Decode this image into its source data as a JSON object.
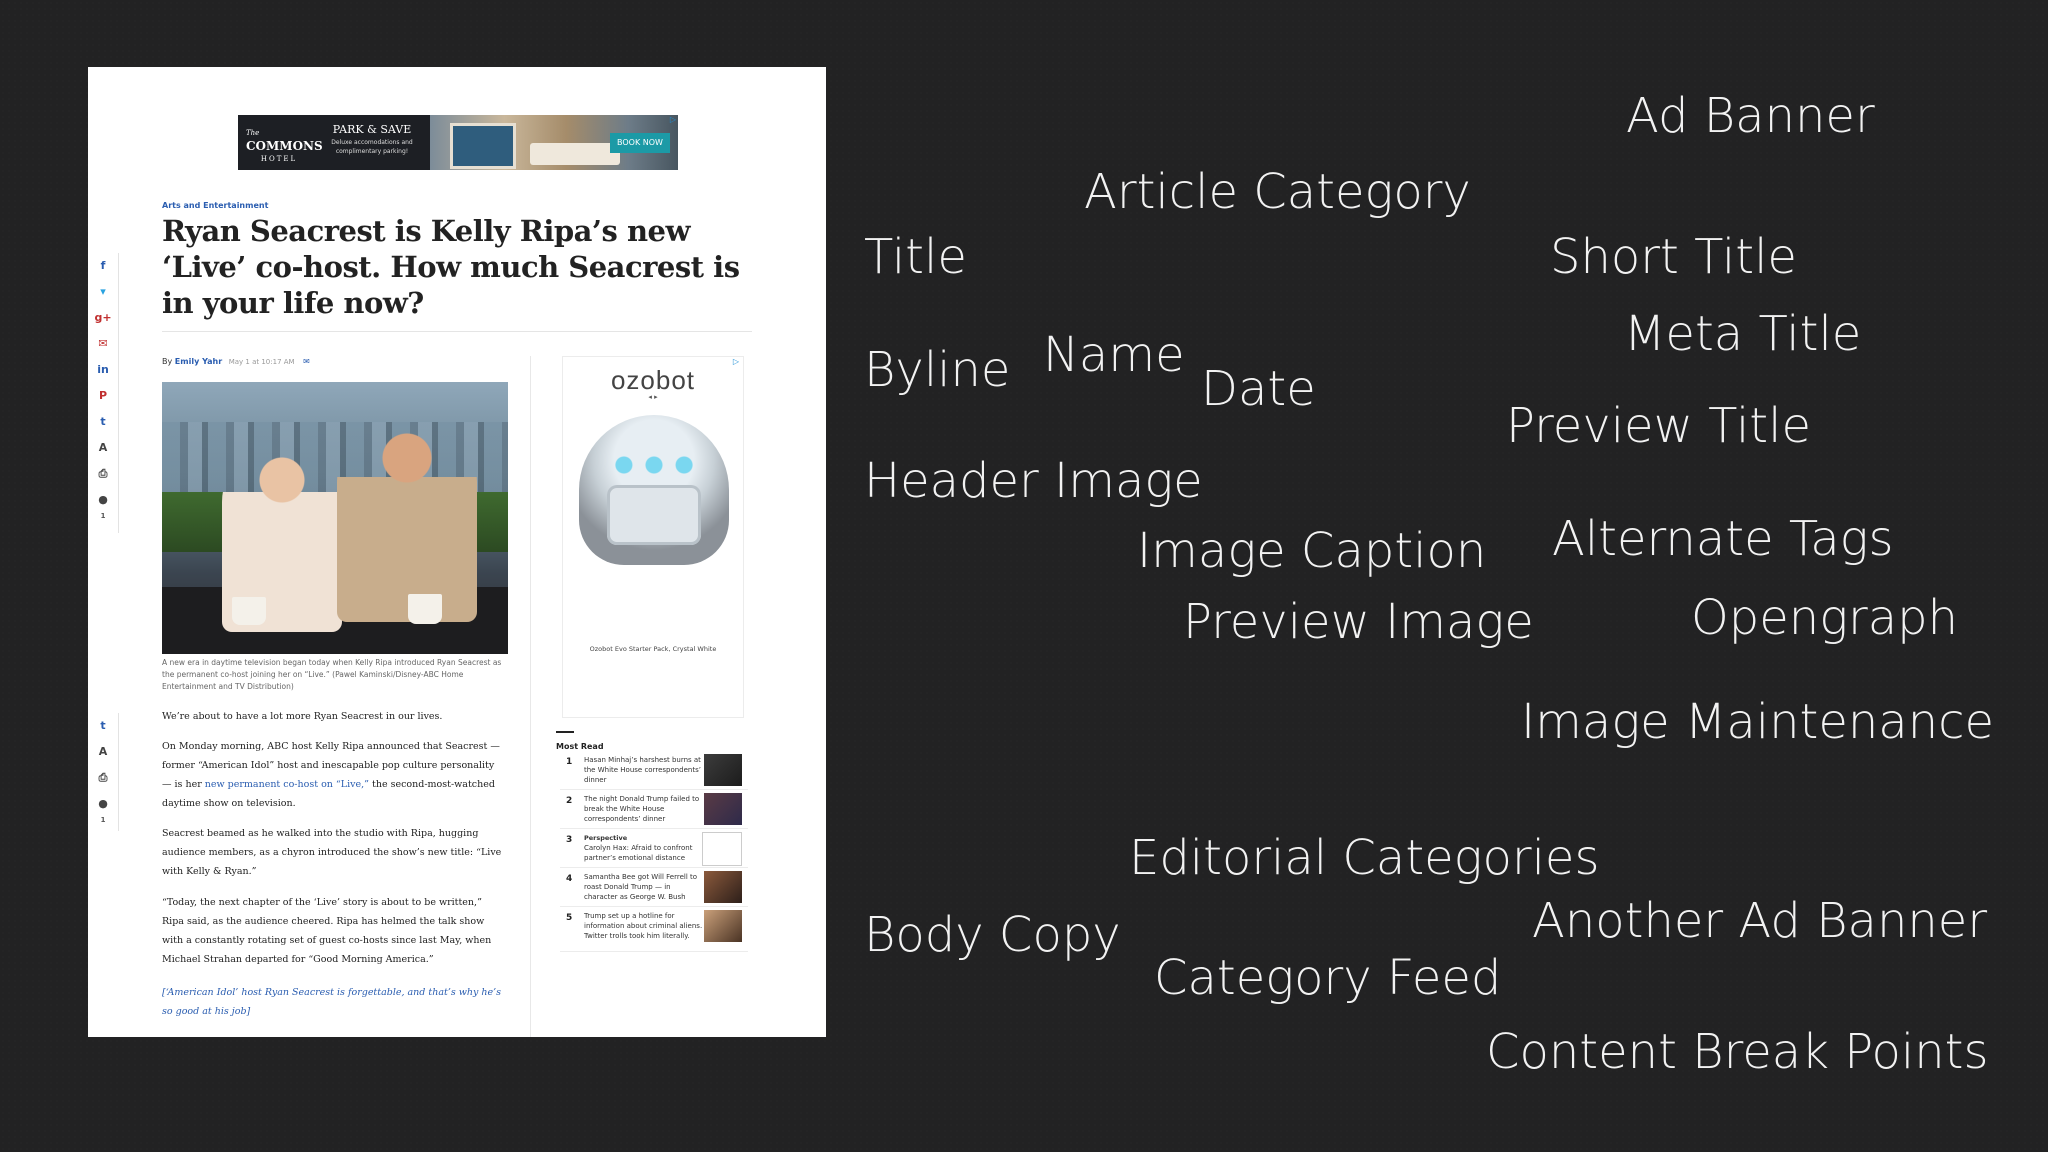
{
  "article_page": {
    "ad_banner": {
      "logo_small": "The",
      "logo": "COMMONS",
      "logo_sub": "HOTEL",
      "headline": "PARK & SAVE",
      "description": "Deluxe accomodations and complimentary parking!",
      "button": "BOOK NOW"
    },
    "category": "Arts and Entertainment",
    "title": "Ryan Seacrest is Kelly Ripa’s new ‘Live’ co-host. How much Seacrest is in your life now?",
    "byline": {
      "prefix": "By",
      "author": "Emily Yahr",
      "date": "May 1 at 10:17 AM"
    },
    "share_rail": {
      "buttons": [
        {
          "icon": "facebook-icon",
          "glyph": "f"
        },
        {
          "icon": "twitter-icon",
          "glyph": "🐦"
        },
        {
          "icon": "googleplus-icon",
          "glyph": "g+"
        },
        {
          "icon": "email-icon",
          "glyph": "✉"
        },
        {
          "icon": "linkedin-icon",
          "glyph": "in"
        },
        {
          "icon": "pinterest-icon",
          "glyph": "P"
        },
        {
          "icon": "tumblr-icon",
          "glyph": "t"
        },
        {
          "icon": "text-size-icon",
          "glyph": "A"
        },
        {
          "icon": "print-icon",
          "glyph": "⎙"
        },
        {
          "icon": "comment-icon",
          "glyph": "💬"
        }
      ],
      "comment_count": "1"
    },
    "caption": "A new era in daytime television began today when Kelly Ripa introduced Ryan Seacrest as the permanent co-host joining her on “Live.” (Pawel Kaminski/Disney-ABC Home Entertainment and TV Distribution)",
    "body": {
      "p1": "We’re about to have a lot more Ryan Seacrest in our lives.",
      "p2_before": "On Monday morning, ABC host Kelly Ripa announced that Seacrest — former “American Idol” host and inescapable pop culture personality — is her ",
      "p2_link": "new permanent co-host on “Live,”",
      "p2_after": " the second-most-watched daytime show on television.",
      "p3": "Seacrest beamed as he walked into the studio with Ripa, hugging audience members, as a chyron introduced the show’s new title: “Live with Kelly & Ryan.”",
      "p4": "“Today, the next chapter of the ‘Live’ story is about to be written,” Ripa said, as the audience cheered. Ripa has helmed the talk show with a constantly rotating set of guest co-hosts since last May, when Michael Strahan departed for “Good Morning America.”",
      "related": "[‘American Idol’ host Ryan Seacrest is forgettable, and that’s why he’s so good at his job]"
    },
    "sidebar_ad": {
      "brand": "ozobot",
      "arrows": "◂        ▸",
      "product": "Ozobot Evo Starter Pack, Crystal White"
    },
    "most_read": {
      "heading": "Most Read",
      "items": [
        {
          "num": "1",
          "kicker": "",
          "text": "Hasan Minhaj’s harshest burns at the White House correspondents’ dinner"
        },
        {
          "num": "2",
          "kicker": "",
          "text": "The night Donald Trump failed to break the White House correspondents’ dinner"
        },
        {
          "num": "3",
          "kicker": "Perspective",
          "text": "Carolyn Hax: Afraid to confront partner’s emotional distance"
        },
        {
          "num": "4",
          "kicker": "",
          "text": "Samantha Bee got Will Ferrell to roast Donald Trump — in character as George W. Bush"
        },
        {
          "num": "5",
          "kicker": "",
          "text": "Trump set up a hotline for information about criminal aliens. Twitter trolls took him literally."
        }
      ]
    }
  },
  "labels": {
    "ad_banner": "Ad Banner",
    "article_category": "Article Category",
    "title": "Title",
    "short_title": "Short Title",
    "meta_title": "Meta Title",
    "byline": "Byline",
    "name": "Name",
    "date": "Date",
    "preview_title": "Preview Title",
    "header_image": "Header Image",
    "image_caption": "Image Caption",
    "alternate_tags": "Alternate Tags",
    "preview_image": "Preview Image",
    "opengraph": "Opengraph",
    "image_maintenance": "Image Maintenance",
    "editorial_categories": "Editorial Categories",
    "body_copy": "Body Copy",
    "another_ad_banner": "Another Ad Banner",
    "category_feed": "Category Feed",
    "content_break_points": "Content Break Points"
  }
}
